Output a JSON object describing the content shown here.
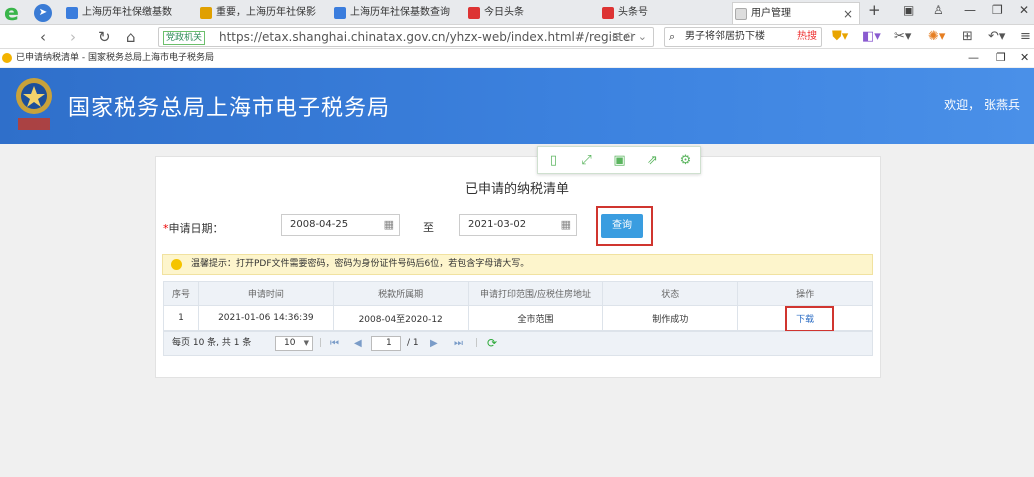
{
  "browser": {
    "tabs": [
      {
        "label": "上海历年社保缴基数",
        "icon_color": "#3b7ddd"
      },
      {
        "label": "重要，上海历年社保影",
        "icon_color": "#e0a000"
      },
      {
        "label": "上海历年社保基数查询",
        "icon_color": "#3b7ddd"
      },
      {
        "label": "今日头条",
        "icon_color": "#d33"
      },
      {
        "label": "头条号",
        "icon_color": "#d33"
      },
      {
        "label": "用户管理",
        "icon_color": "#cccccc",
        "active": true
      }
    ],
    "tab_close": "×",
    "new_tab": "+",
    "gov_badge": "党政机关",
    "url": "https://etax.shanghai.chinatax.gov.cn/yhzx-web/index.html#/register",
    "search_text": "男子将邻居扔下楼",
    "search_hot": "热搜",
    "page_title": "已申请纳税清单 - 国家税务总局上海市电子税务局"
  },
  "header": {
    "title": "国家税务总局上海市电子税务局",
    "welcome": "欢迎，  张燕兵"
  },
  "page": {
    "title": "已申请的纳税清单",
    "date_label": "申请日期：",
    "required_mark": "*",
    "start_date": "2008-04-25",
    "to_label": "至",
    "end_date": "2021-03-02",
    "query_button": "查询",
    "tip": "温馨提示：打开PDF文件需要密码，密码为身份证件号码后6位，若包含字母请大写。"
  },
  "table": {
    "headers": [
      "序号",
      "申请时间",
      "税款所属期",
      "申请打印范围/应税住房地址",
      "状态",
      "操作"
    ],
    "rows": [
      [
        "1",
        "2021-01-06 14:36:39",
        "2008-04至2020-12",
        "全市范围",
        "制作成功",
        "下载"
      ]
    ]
  },
  "pager": {
    "summary": "每页 10 条, 共 1 条",
    "page_size": "10",
    "current_page": "1",
    "total_pages": "/ 1"
  }
}
